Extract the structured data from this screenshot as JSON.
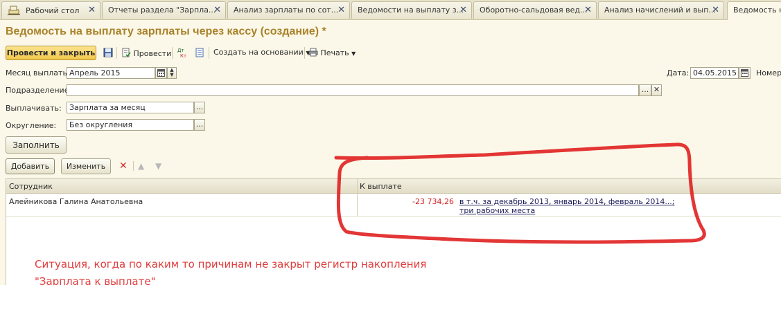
{
  "tabs": [
    {
      "label": "Рабочий стол"
    },
    {
      "label": "Отчеты раздела \"Зарпла..."
    },
    {
      "label": "Анализ зарплаты по сот..."
    },
    {
      "label": "Ведомости на выплату з..."
    },
    {
      "label": "Оборотно-сальдовая вед..."
    },
    {
      "label": "Анализ начислений и вып..."
    },
    {
      "label": "Ведомость на в"
    }
  ],
  "window": {
    "title": "Ведомость на выплату зарплаты через кассу (создание) *"
  },
  "toolbar": {
    "post_close_label": "Провести и закрыть",
    "post_label": "Провести",
    "create_basis_label": "Создать на основании",
    "print_label": "Печать"
  },
  "form": {
    "month_label": "Месяц выплаты:",
    "month_value": "Апрель 2015",
    "date_label": "Дата:",
    "date_value": "04.05.2015",
    "number_label": "Номер:",
    "department_label": "Подразделение:",
    "department_value": "",
    "pay_label": "Выплачивать:",
    "pay_value": "Зарплата за месяц",
    "round_label": "Округление:",
    "round_value": "Без округления",
    "fill_label": "Заполнить",
    "add_label": "Добавить",
    "edit_label": "Изменить"
  },
  "table": {
    "columns": [
      "Сотрудник",
      "К выплате"
    ],
    "rows": [
      {
        "employee": "Алейникова Галина Анатольевна",
        "amount": "-23 734,26",
        "detail_line1": "в т.ч. за декабрь 2013, январь 2014, февраль 2014...;",
        "detail_line2": "три рабочих места"
      }
    ]
  },
  "annotation": {
    "line1": "Ситуация, когда по каким то причинам не закрыт регистр накопления",
    "line2": "\"Зарплата к выплате\"",
    "color": "#e03b3b"
  },
  "colors": {
    "accent_title": "#a9822a",
    "primary_button": "#f2c94c",
    "negative": "#d02020"
  }
}
